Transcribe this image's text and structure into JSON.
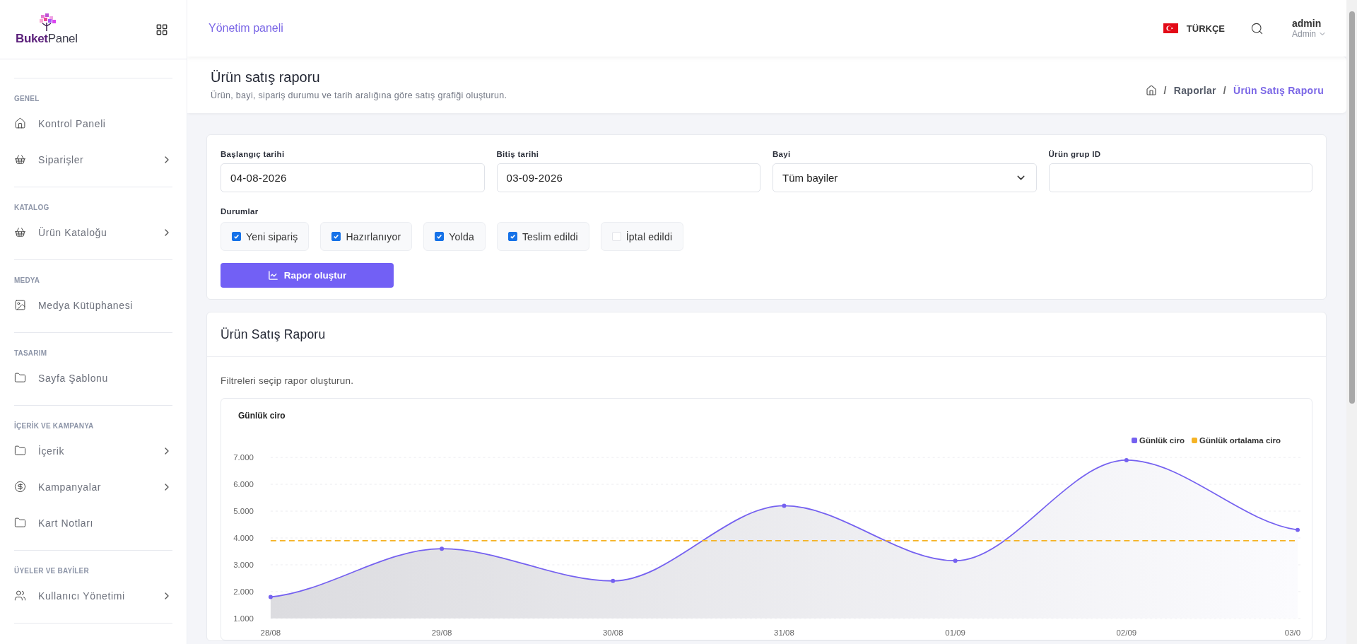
{
  "sidebar": {
    "logo": "**Buket**Panel",
    "sections": [
      {
        "title": "GENEL",
        "items": [
          {
            "label": "Kontrol Paneli",
            "kind": "home",
            "has_submenu": false
          },
          {
            "label": "Siparişler",
            "kind": "basket",
            "has_submenu": true
          }
        ]
      },
      {
        "title": "KATALOG",
        "items": [
          {
            "label": "Ürün Kataloğu",
            "kind": "basket",
            "has_submenu": true
          }
        ]
      },
      {
        "title": "MEDYA",
        "items": [
          {
            "label": "Medya Kütüphanesi",
            "kind": "image",
            "has_submenu": false
          }
        ]
      },
      {
        "title": "TASARIM",
        "items": [
          {
            "label": "Sayfa Şablonu",
            "kind": "folder",
            "has_submenu": false
          }
        ]
      },
      {
        "title": "İÇERİK VE KAMPANYA",
        "items": [
          {
            "label": "İçerik",
            "kind": "folder",
            "has_submenu": true
          },
          {
            "label": "Kampanyalar",
            "kind": "dollar",
            "has_submenu": true
          },
          {
            "label": "Kart Notları",
            "kind": "folder",
            "has_submenu": false
          }
        ]
      },
      {
        "title": "ÜYELER VE BAYİLER",
        "items": [
          {
            "label": "Kullanıcı Yönetimi",
            "kind": "users",
            "has_submenu": true
          }
        ]
      }
    ]
  },
  "header": {
    "title": "Yönetim paneli",
    "language": "TÜRKÇE",
    "user": {
      "name": "admin",
      "role": "Admin"
    }
  },
  "page": {
    "title": "Ürün satış raporu",
    "subtitle": "Ürün, bayi, sipariş durumu ve tarih aralığına göre satış grafiği oluşturun.",
    "breadcrumb": [
      {
        "separator": "/",
        "label": "Raporlar",
        "current": false
      },
      {
        "separator": "/",
        "label": "Ürün Satış Raporu",
        "current": true
      }
    ]
  },
  "filters": {
    "fields": [
      {
        "label": "Başlangıç tarihi",
        "value": "04-08-2026",
        "kind": "date"
      },
      {
        "label": "Bitiş tarihi",
        "value": "03-09-2026",
        "kind": "date"
      },
      {
        "label": "Bayi",
        "value": "Tüm bayiler",
        "kind": "select"
      },
      {
        "label": "Ürün grup ID",
        "kind": "text"
      }
    ],
    "statuses_label": "Durumlar",
    "statuses": [
      {
        "label": "Yeni sipariş",
        "checked": true
      },
      {
        "label": "Hazırlanıyor",
        "checked": true
      },
      {
        "label": "Yolda",
        "checked": true
      },
      {
        "label": "Teslim edildi",
        "checked": true
      },
      {
        "label": "İptal edildi",
        "checked": false
      }
    ],
    "button": "Rapor oluştur"
  },
  "report": {
    "title": "Ürün Satış Raporu",
    "hint": "Filtreleri seçip rapor oluşturun.",
    "chart": {
      "chart_data": {
        "type": "area",
        "title": "Günlük ciro",
        "grid": true,
        "categories": [
          "28/08",
          "29/08",
          "30/08",
          "31/08",
          "01/09",
          "02/09",
          "03/0"
        ],
        "series": [
          {
            "name": "Günlük ciro",
            "color": "#7561f0",
            "marker": true,
            "line_style": "solid",
            "values": [
              1800,
              3600,
              2400,
              5200,
              3150,
              6900,
              4300
            ]
          },
          {
            "name": "Günlük ortalama ciro",
            "color": "#f5b325",
            "type": "line",
            "marker": false,
            "line_style": "dashed",
            "values": [
              3900,
              3900,
              3900,
              3900,
              3900,
              3900,
              3900
            ]
          }
        ],
        "ylim": [
          1000,
          7000
        ],
        "yticks": [
          {
            "value": 1000,
            "label": "1.000"
          },
          {
            "value": 2000,
            "label": "2.000"
          },
          {
            "value": 3000,
            "label": "3.000"
          },
          {
            "value": 4000,
            "label": "4.000"
          },
          {
            "value": 5000,
            "label": "5.000"
          },
          {
            "value": 6000,
            "label": "6.000"
          },
          {
            "value": 7000,
            "label": "7.000"
          }
        ]
      }
    }
  }
}
